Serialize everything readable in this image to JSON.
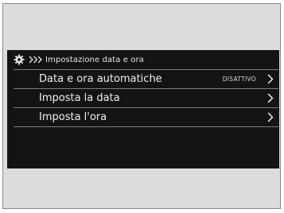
{
  "header": {
    "icon": "gear-icon",
    "breadcrumb_icon": "chevron-triple-right-icon",
    "title": "Impostazione data e ora"
  },
  "items": [
    {
      "label": "Data e ora automatiche",
      "value": "DISATTIVO",
      "icon": "chevron-right-icon"
    },
    {
      "label": "Imposta la data",
      "value": "",
      "icon": "chevron-right-icon"
    },
    {
      "label": "Imposta l'ora",
      "value": "",
      "icon": "chevron-right-icon"
    }
  ],
  "colors": {
    "screen_background": "#141414",
    "text": "#f0f0f0",
    "divider": "#7c7c7c",
    "frame": "#dcdcdc"
  }
}
